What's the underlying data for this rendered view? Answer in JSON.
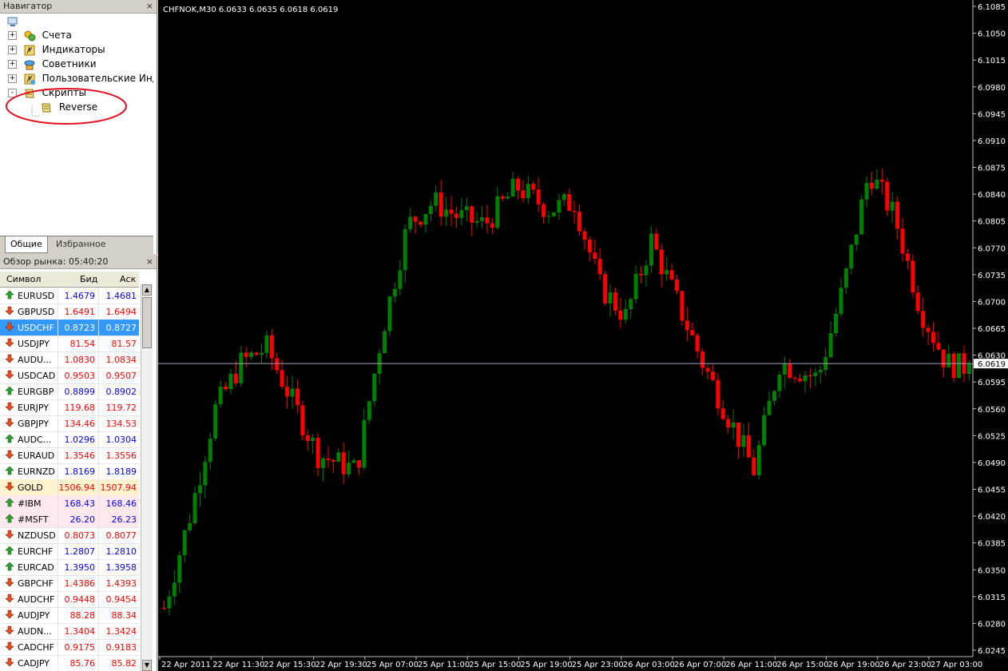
{
  "navigator": {
    "title": "Навигатор",
    "close": "×",
    "items": [
      {
        "label": "Счета",
        "icon": "accounts-icon",
        "expander": "+"
      },
      {
        "label": "Индикаторы",
        "icon": "indicators-icon",
        "expander": "+"
      },
      {
        "label": "Советники",
        "icon": "experts-icon",
        "expander": "+"
      },
      {
        "label": "Пользовательские Индик",
        "icon": "custom-indicators-icon",
        "expander": "+"
      },
      {
        "label": "Скрипты",
        "icon": "scripts-icon",
        "expander": "-"
      },
      {
        "label": "Reverse",
        "icon": "script-icon",
        "expander": ""
      }
    ],
    "tabs": [
      "Общие",
      "Избранное"
    ]
  },
  "market_watch": {
    "title": "Обзор рынка: 05:40:20",
    "close": "×",
    "columns": [
      "Символ",
      "Бид",
      "Аск"
    ],
    "rows": [
      {
        "symbol": "EURUSD",
        "bid": "1.4679",
        "ask": "1.4681",
        "dir": "up",
        "color": "#0000ff"
      },
      {
        "symbol": "GBPUSD",
        "bid": "1.6491",
        "ask": "1.6494",
        "dir": "down",
        "color": "#ff0000"
      },
      {
        "symbol": "USDCHF",
        "bid": "0.8723",
        "ask": "0.8727",
        "dir": "down",
        "color": "#ffffff"
      },
      {
        "symbol": "USDJPY",
        "bid": "81.54",
        "ask": "81.57",
        "dir": "down",
        "color": "#ff0000"
      },
      {
        "symbol": "AUDU...",
        "bid": "1.0830",
        "ask": "1.0834",
        "dir": "down",
        "color": "#ff0000"
      },
      {
        "symbol": "USDCAD",
        "bid": "0.9503",
        "ask": "0.9507",
        "dir": "down",
        "color": "#ff0000"
      },
      {
        "symbol": "EURGBP",
        "bid": "0.8899",
        "ask": "0.8902",
        "dir": "up",
        "color": "#0000ff"
      },
      {
        "symbol": "EURJPY",
        "bid": "119.68",
        "ask": "119.72",
        "dir": "down",
        "color": "#ff0000"
      },
      {
        "symbol": "GBPJPY",
        "bid": "134.46",
        "ask": "134.53",
        "dir": "down",
        "color": "#ff0000"
      },
      {
        "symbol": "AUDC...",
        "bid": "1.0296",
        "ask": "1.0304",
        "dir": "up",
        "color": "#0000ff"
      },
      {
        "symbol": "EURAUD",
        "bid": "1.3546",
        "ask": "1.3556",
        "dir": "down",
        "color": "#ff0000"
      },
      {
        "symbol": "EURNZD",
        "bid": "1.8169",
        "ask": "1.8189",
        "dir": "up",
        "color": "#0000ff"
      },
      {
        "symbol": "GOLD",
        "bid": "1506.94",
        "ask": "1507.94",
        "dir": "down",
        "color": "#ff0000"
      },
      {
        "symbol": "#IBM",
        "bid": "168.43",
        "ask": "168.46",
        "dir": "up",
        "color": "#0000ff"
      },
      {
        "symbol": "#MSFT",
        "bid": "26.20",
        "ask": "26.23",
        "dir": "up",
        "color": "#0000ff"
      },
      {
        "symbol": "NZDUSD",
        "bid": "0.8073",
        "ask": "0.8077",
        "dir": "down",
        "color": "#ff0000"
      },
      {
        "symbol": "EURCHF",
        "bid": "1.2807",
        "ask": "1.2810",
        "dir": "up",
        "color": "#0000ff"
      },
      {
        "symbol": "EURCAD",
        "bid": "1.3950",
        "ask": "1.3958",
        "dir": "up",
        "color": "#0000ff"
      },
      {
        "symbol": "GBPCHF",
        "bid": "1.4386",
        "ask": "1.4393",
        "dir": "down",
        "color": "#ff0000"
      },
      {
        "symbol": "AUDCHF",
        "bid": "0.9448",
        "ask": "0.9454",
        "dir": "down",
        "color": "#ff0000"
      },
      {
        "symbol": "AUDJPY",
        "bid": "88.28",
        "ask": "88.34",
        "dir": "down",
        "color": "#ff0000"
      },
      {
        "symbol": "AUDN...",
        "bid": "1.3404",
        "ask": "1.3424",
        "dir": "down",
        "color": "#ff0000"
      },
      {
        "symbol": "CADCHF",
        "bid": "0.9175",
        "ask": "0.9183",
        "dir": "down",
        "color": "#ff0000"
      },
      {
        "symbol": "CADJPY",
        "bid": "85.76",
        "ask": "85.82",
        "dir": "down",
        "color": "#ff0000"
      }
    ]
  },
  "chart": {
    "header": "CHFNOK,M30  6.0633 6.0635 6.0618 6.0619",
    "current_price": "6.0619",
    "current_value": 6.0619,
    "ylim": [
      6.0245,
      6.1085
    ],
    "yticks": [
      "6.1085",
      "6.1050",
      "6.1015",
      "6.0980",
      "6.0945",
      "6.0910",
      "6.0875",
      "6.0840",
      "6.0805",
      "6.0770",
      "6.0735",
      "6.0700",
      "6.0665",
      "6.0630",
      "6.0595",
      "6.0560",
      "6.0525",
      "6.0490",
      "6.0455",
      "6.0420",
      "6.0385",
      "6.0350",
      "6.0315",
      "6.0280",
      "6.0245"
    ],
    "xticks": [
      "22 Apr 2011",
      "22 Apr 11:30",
      "22 Apr 15:30",
      "22 Apr 19:30",
      "25 Apr 07:00",
      "25 Apr 11:00",
      "25 Apr 15:00",
      "25 Apr 19:00",
      "25 Apr 23:00",
      "26 Apr 03:00",
      "26 Apr 07:00",
      "26 Apr 11:00",
      "26 Apr 15:00",
      "26 Apr 19:00",
      "26 Apr 23:00",
      "27 Apr 03:00"
    ],
    "up_color": "#008000",
    "down_color": "#ff0000",
    "line_color": "#a0a8b8"
  }
}
